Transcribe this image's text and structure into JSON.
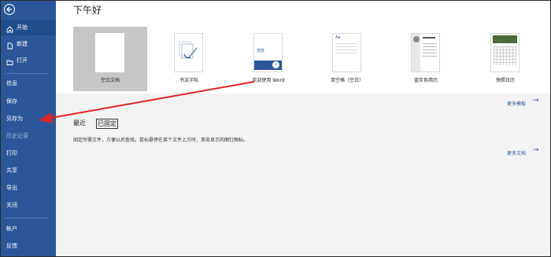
{
  "sidebar": {
    "items": [
      {
        "label": "开始",
        "icon": "home-icon"
      },
      {
        "label": "新建",
        "icon": "new-document-icon"
      },
      {
        "label": "打开",
        "icon": "open-folder-icon"
      },
      {
        "label": "信息"
      },
      {
        "label": "保存"
      },
      {
        "label": "另存为"
      },
      {
        "label": "历史记录"
      },
      {
        "label": "打印"
      },
      {
        "label": "共享"
      },
      {
        "label": "导出"
      },
      {
        "label": "关闭"
      },
      {
        "label": "帐户"
      },
      {
        "label": "反馈"
      }
    ]
  },
  "header": {
    "greeting": "下午好"
  },
  "templates": [
    {
      "label": "空白文档"
    },
    {
      "label": "书法字帖"
    },
    {
      "label": "欢迎使用 Word",
      "thumb_text": "浏览"
    },
    {
      "label": "单空格（空白）",
      "thumb_text": "Aa"
    },
    {
      "label": "蓝灰色简历"
    },
    {
      "label": "快照日历"
    }
  ],
  "more_templates": "更多模板",
  "tabs": {
    "recent": "最近",
    "pinned": "已固定"
  },
  "hint": "固定所需文件，方便以后查找。鼠标悬停在某个文件上方时，单击显示的图钉图标。",
  "more_documents": "更多文档",
  "colors": {
    "sidebar": "#2b579a",
    "arrow": "#e02424"
  }
}
